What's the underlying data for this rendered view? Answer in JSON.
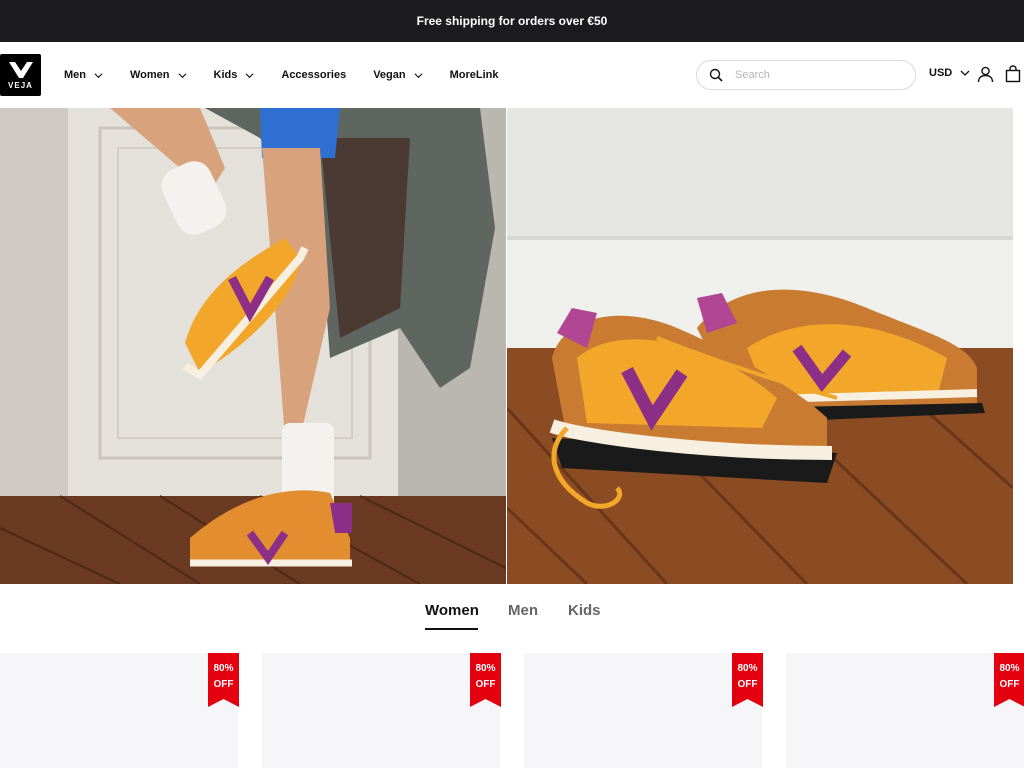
{
  "announcement": "Free shipping for orders over €50",
  "logo": {
    "text": "VEJA",
    "icon": "veja-v-logo"
  },
  "nav": [
    {
      "label": "Men",
      "has_dropdown": true
    },
    {
      "label": "Women",
      "has_dropdown": true
    },
    {
      "label": "Kids",
      "has_dropdown": true
    },
    {
      "label": "Accessories",
      "has_dropdown": false
    },
    {
      "label": "Vegan",
      "has_dropdown": true
    },
    {
      "label": "MoreLink",
      "has_dropdown": false
    }
  ],
  "search": {
    "placeholder": "Search",
    "value": ""
  },
  "currency": {
    "selected": "USD"
  },
  "icons": {
    "search": "search-icon",
    "account": "user-icon",
    "cart": "bag-icon"
  },
  "tabs": [
    {
      "label": "Women",
      "active": true
    },
    {
      "label": "Men",
      "active": false
    },
    {
      "label": "Kids",
      "active": false
    }
  ],
  "products": [
    {
      "badge": {
        "line1": "80%",
        "line2": "OFF"
      }
    },
    {
      "badge": {
        "line1": "80%",
        "line2": "OFF"
      }
    },
    {
      "badge": {
        "line1": "80%",
        "line2": "OFF"
      }
    },
    {
      "badge": {
        "line1": "80%",
        "line2": "OFF"
      }
    }
  ],
  "colors": {
    "announcement_bg": "#1c1c1e",
    "badge_red": "#e3000f",
    "sneaker_orange": "#f2a62a",
    "sneaker_purple": "#8e2f87"
  }
}
